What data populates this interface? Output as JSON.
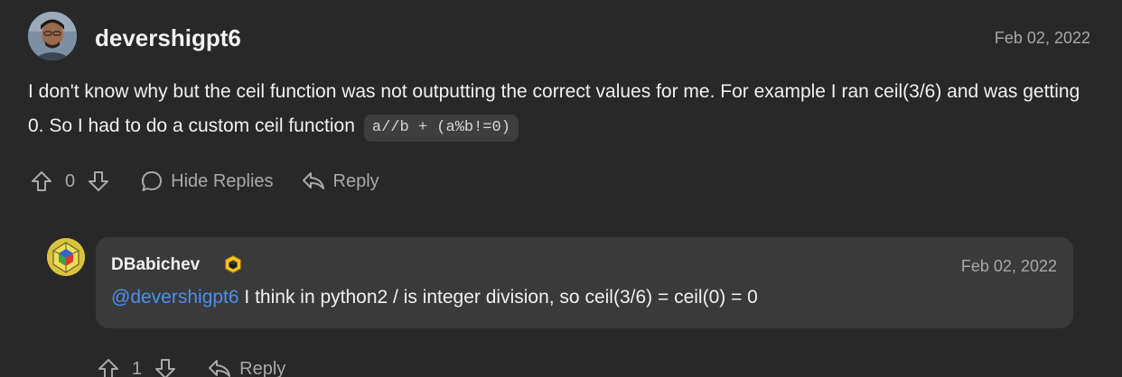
{
  "comment": {
    "author": "devershigpt6",
    "date": "Feb 02, 2022",
    "body_text": "I don't know why but the ceil function was not outputting the correct values for me. For example I ran ceil(3/6) and was getting 0. So I had to do a custom ceil function",
    "code": "a//b + (a%b!=0)",
    "vote_count": "0",
    "hide_replies_label": "Hide Replies",
    "reply_label": "Reply"
  },
  "reply": {
    "author": "DBabichev",
    "date": "Feb 02, 2022",
    "mention": "@devershigpt6",
    "body_text": " I think in python2 / is integer division, so ceil(3/6) = ceil(0) = 0",
    "vote_count": "1",
    "reply_label": "Reply"
  },
  "icons": {
    "upvote": "arrow-up-icon",
    "downvote": "arrow-down-icon",
    "comment": "comment-bubble-icon",
    "reply": "reply-arrow-icon",
    "badge": "cube-badge-icon"
  },
  "colors": {
    "background": "#282828",
    "card": "#3a3a3a",
    "mention": "#4d8ef0",
    "muted": "#a9a9a9",
    "badge": "#f5c21a"
  }
}
